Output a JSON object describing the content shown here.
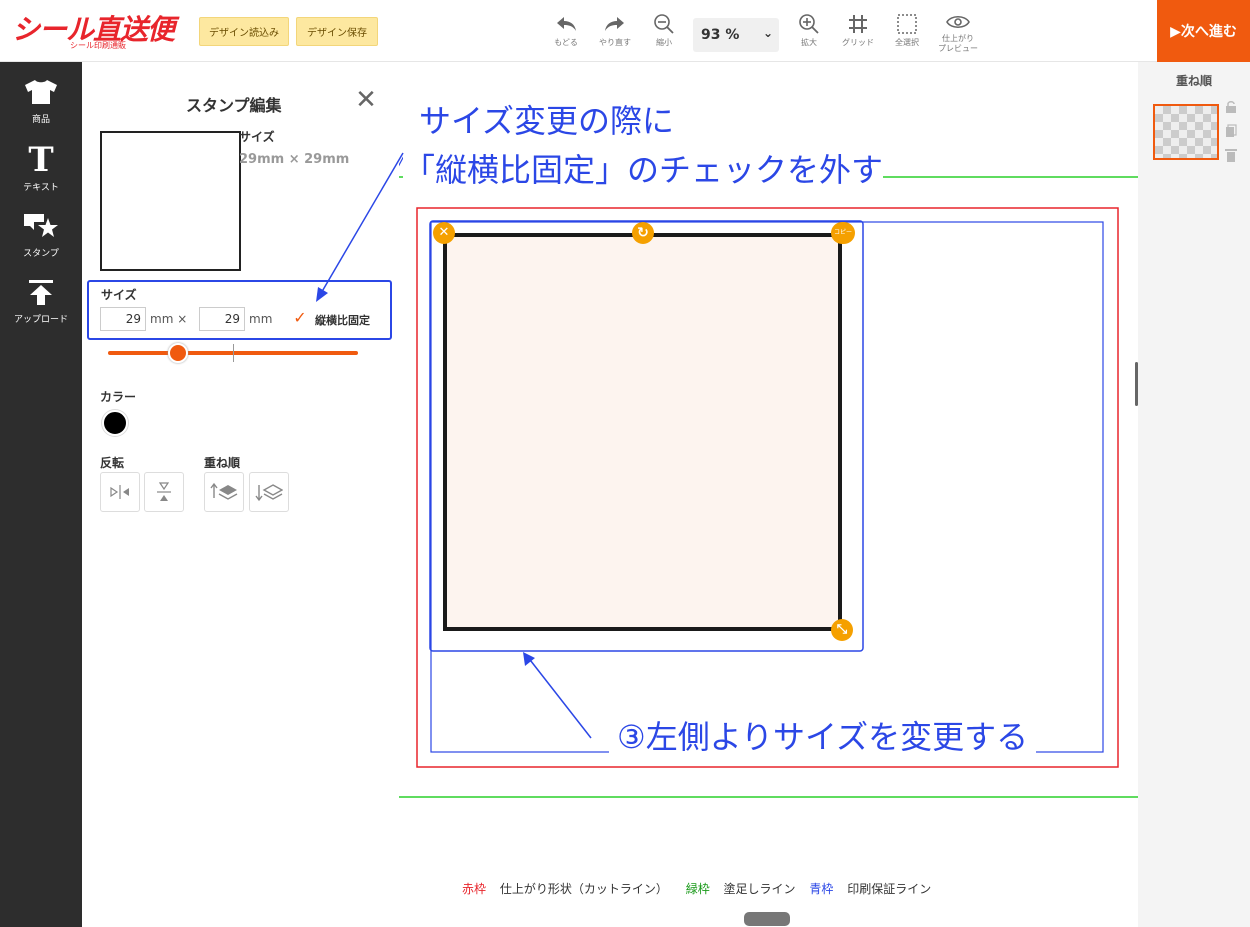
{
  "brand": {
    "name": "シール直送便",
    "sub": "シール印刷通販"
  },
  "header": {
    "load_label": "デザイン読込み",
    "save_label": "デザイン保存",
    "tools": [
      {
        "label": "もどる",
        "icon": "undo-icon"
      },
      {
        "label": "やり直す",
        "icon": "redo-icon"
      },
      {
        "label": "縮小",
        "icon": "zoom-out-icon"
      },
      {
        "label": "拡大",
        "icon": "zoom-in-icon"
      },
      {
        "label": "グリッド",
        "icon": "grid-icon"
      },
      {
        "label": "全選択",
        "icon": "select-all-icon"
      },
      {
        "label1": "仕上がり",
        "label2": "プレビュー",
        "icon": "eye-icon"
      }
    ],
    "zoom": "93 %",
    "next_label": "▶次へ進む"
  },
  "sidebar": {
    "items": [
      {
        "label": "商品",
        "icon": "tshirt-icon"
      },
      {
        "label": "テキスト",
        "icon": "text-icon"
      },
      {
        "label": "スタンプ",
        "icon": "stamp-icon"
      },
      {
        "label": "アップロード",
        "icon": "upload-icon"
      }
    ]
  },
  "panel": {
    "title": "スタンプ編集",
    "info_size_label": "サイズ",
    "info_size_value": "29mm × 29mm",
    "size_label": "サイズ",
    "width": "29",
    "height": "29",
    "unit_x": "mm ×",
    "unit": "mm",
    "aspect_lock_label": "縦横比固定",
    "aspect_lock_checked": true,
    "slider_level": 0.28,
    "color_label": "カラー",
    "color_value": "#000000",
    "flip_label": "反転",
    "order_label": "重ね順"
  },
  "layers": {
    "title": "重ね順"
  },
  "annotations": {
    "line1": "サイズ変更の際に",
    "line2": "「縦横比固定」のチェックを外す",
    "line3": "③左側よりサイズを変更する"
  },
  "handles": {
    "copy": "コピー"
  },
  "legend": {
    "red": "赤枠",
    "red_desc": "仕上がり形状（カットライン）",
    "green": "緑枠",
    "green_desc": "塗足しライン",
    "blue": "青枠",
    "blue_desc": "印刷保証ライン"
  },
  "colors": {
    "accent": "#f05a0f",
    "annotation": "#2b47e6",
    "cut_line": "#e8252c",
    "bleed_line": "#1a9a1a"
  }
}
